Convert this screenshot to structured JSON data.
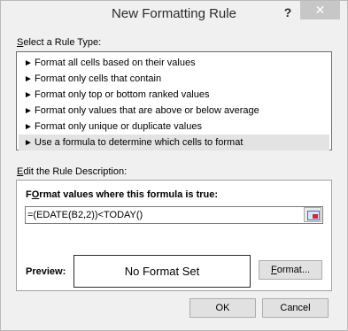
{
  "dialog": {
    "title": "New Formatting Rule",
    "help_label": "?",
    "close_label": "✕"
  },
  "rule_type": {
    "label": "Select a Rule Type:",
    "label_mnemonic": "S",
    "label_rest": "elect a Rule Type:",
    "items": [
      {
        "label": "Format all cells based on their values",
        "selected": false
      },
      {
        "label": "Format only cells that contain",
        "selected": false
      },
      {
        "label": "Format only top or bottom ranked values",
        "selected": false
      },
      {
        "label": "Format only values that are above or below average",
        "selected": false
      },
      {
        "label": "Format only unique or duplicate values",
        "selected": false
      },
      {
        "label": "Use a formula to determine which cells to format",
        "selected": true
      }
    ]
  },
  "description": {
    "label": "Edit the Rule Description:",
    "label_mnemonic": "E",
    "label_rest": "dit the Rule Description:",
    "formula_label": "Format values where this formula is true:",
    "formula_mnemonic": "O",
    "formula_label_pre": "F",
    "formula_label_rest": "rmat values where this formula is true:",
    "formula_value": "=(EDATE(B2,2))<TODAY()",
    "preview_label": "Preview:",
    "preview_text": "No Format Set",
    "format_button": "Format...",
    "format_mnemonic": "F",
    "format_rest": "ormat..."
  },
  "buttons": {
    "ok": "OK",
    "cancel": "Cancel"
  }
}
